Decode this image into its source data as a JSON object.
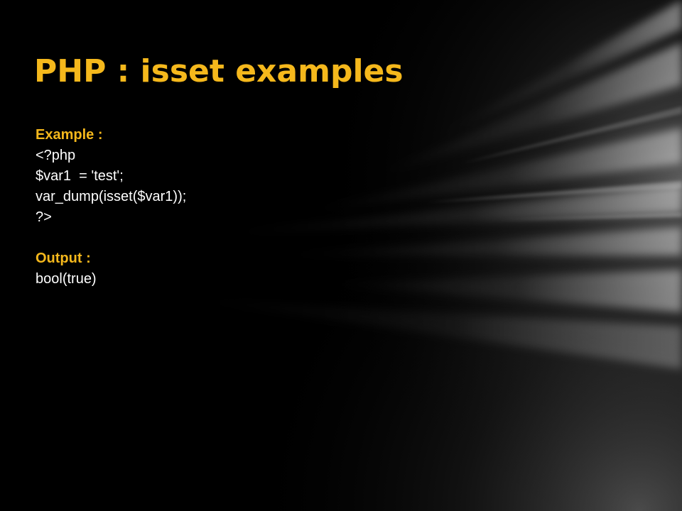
{
  "slide": {
    "title": "PHP : isset examples",
    "example_label": "Example :",
    "code_lines": [
      "<?php",
      "$var1  = 'test';",
      "var_dump(isset($var1));",
      "?>"
    ],
    "output_label": "Output :",
    "output_lines": [
      "bool(true)"
    ]
  },
  "colors": {
    "background": "#000000",
    "accent": "#f5b81c",
    "text": "#ffffff"
  }
}
